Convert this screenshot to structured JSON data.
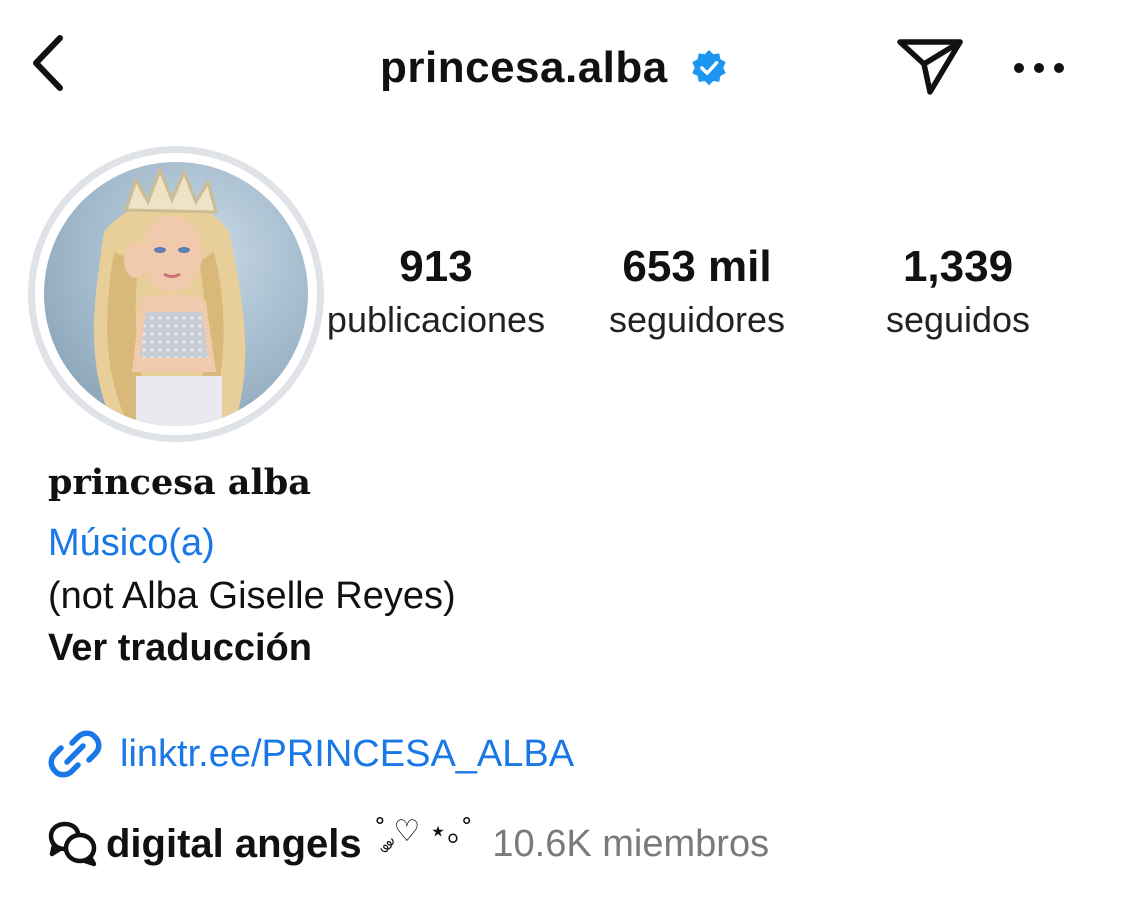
{
  "header": {
    "username": "princesa.alba",
    "verified": true,
    "icons": [
      "back-chevron-icon",
      "verified-badge-icon",
      "paper-plane-icon",
      "more-dots-icon"
    ]
  },
  "profile": {
    "stats": [
      {
        "value": "913",
        "label": "publicaciones"
      },
      {
        "value": "653 mil",
        "label": "seguidores"
      },
      {
        "value": "1,339",
        "label": "seguidos"
      }
    ],
    "display_name": "princesa alba",
    "category": "Músico(a)",
    "bio": "(not Alba Giselle Reyes)",
    "translate_label": "Ver traducción",
    "link": "linktr.ee/PRINCESA_ALBA",
    "channel": {
      "name": "digital angels",
      "decoration": "˚ ༘♡ ⋆｡˚",
      "members": "10.6K miembros"
    }
  },
  "colors": {
    "accent_link": "#1a77e6",
    "verified_blue": "#1c96f0",
    "story_ring": "#dfe2e6",
    "muted_text": "#7a7a7a"
  }
}
